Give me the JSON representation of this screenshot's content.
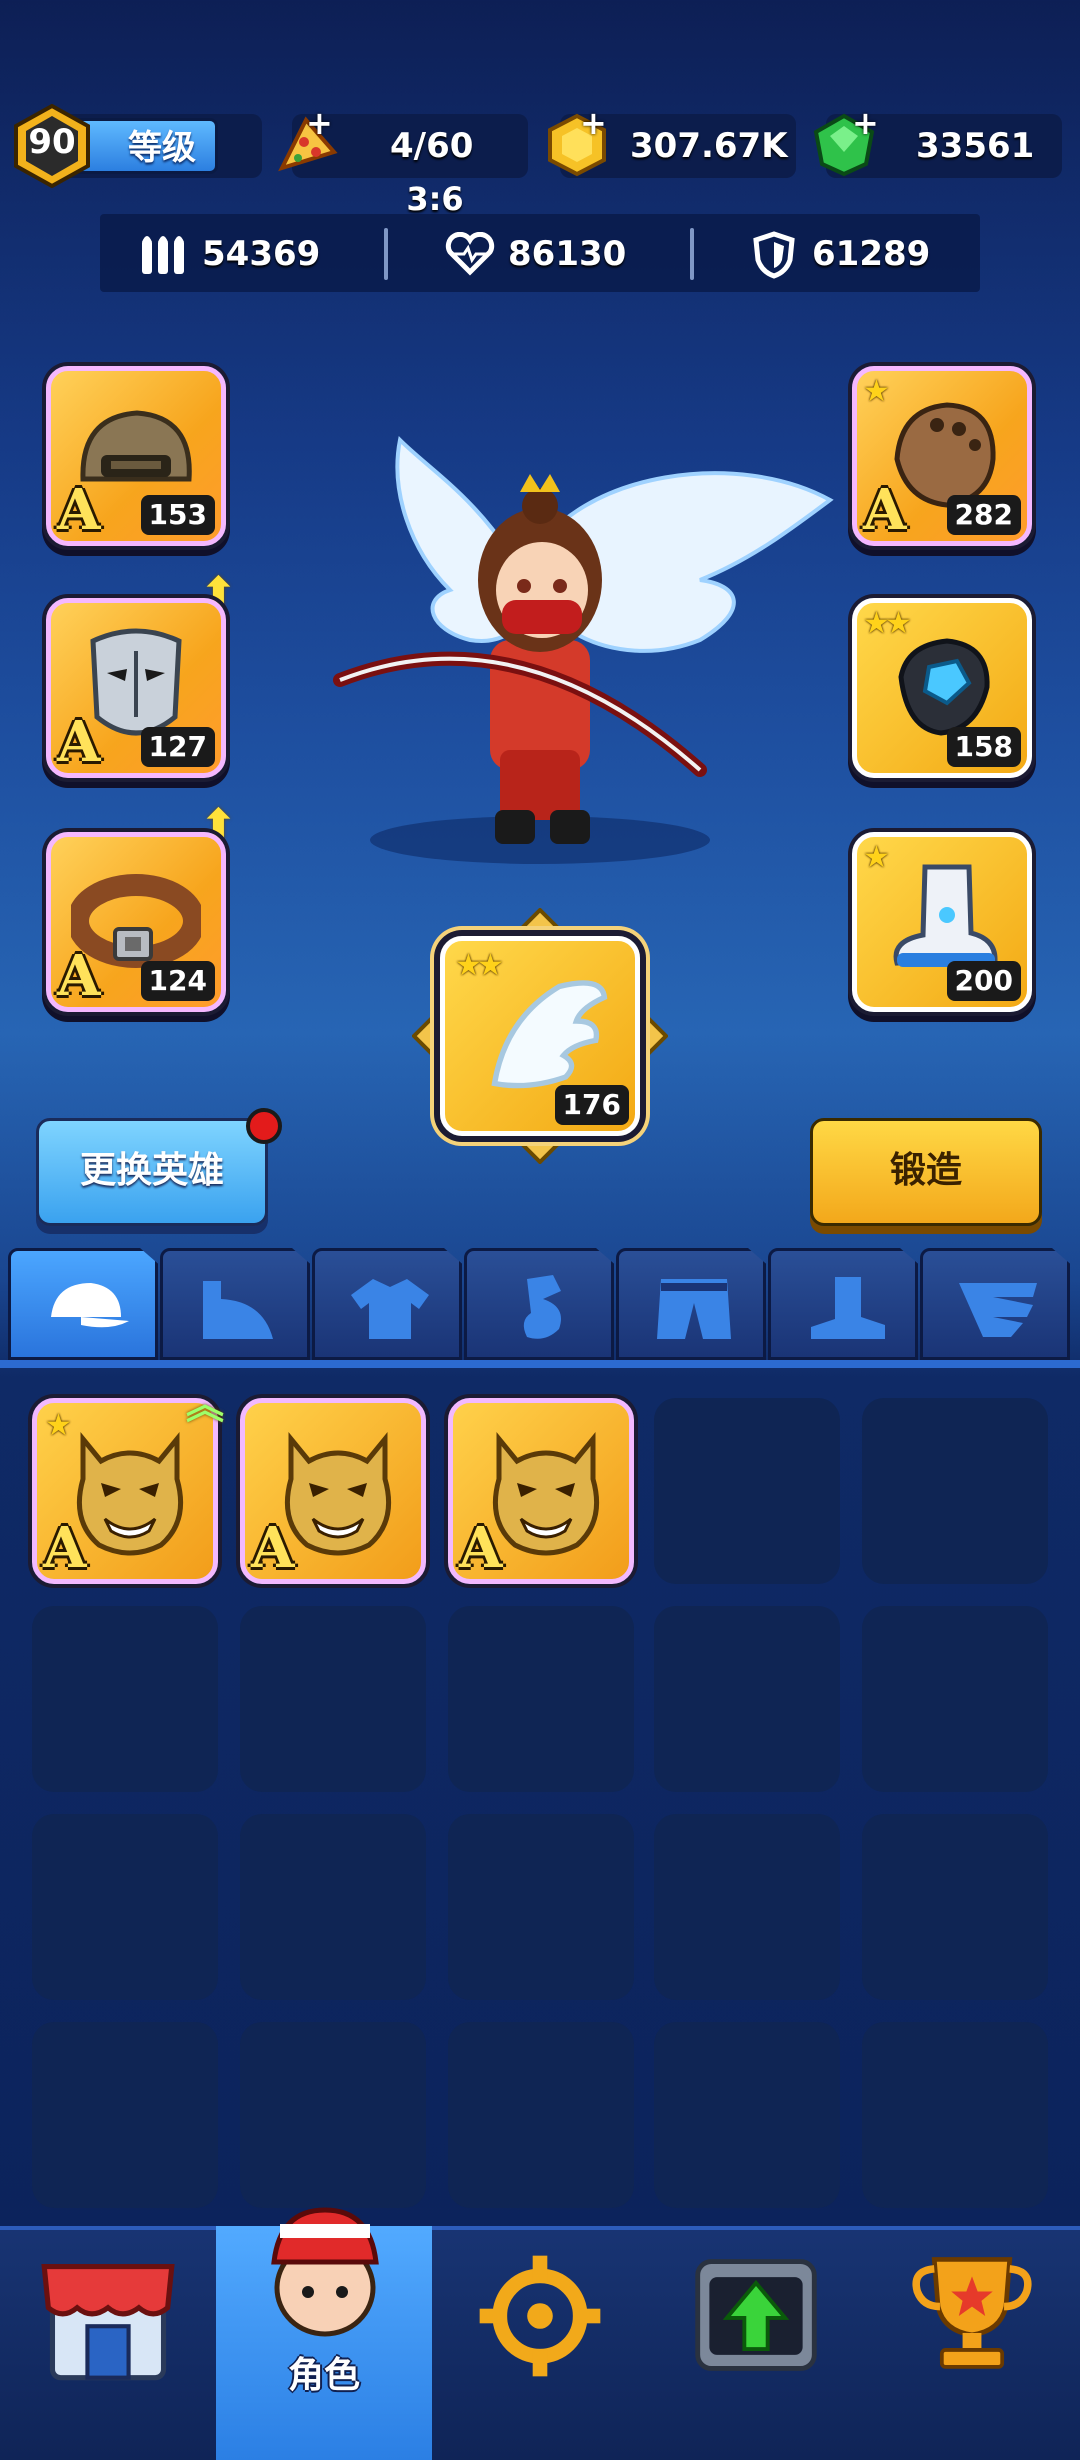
{
  "header": {
    "level": "90",
    "level_label": "等级",
    "energy": "4/60",
    "energy_timer": "3:6",
    "gold": "307.67K",
    "gems": "33561"
  },
  "stats": {
    "attack": "54369",
    "health": "86130",
    "defense": "61289"
  },
  "equipment": {
    "helmet": {
      "grade": "A",
      "level": "153"
    },
    "mask": {
      "grade": "A",
      "level": "127"
    },
    "belt": {
      "grade": "A",
      "level": "124"
    },
    "gauntlet": {
      "grade": "A",
      "level": "282"
    },
    "glove": {
      "level": "158"
    },
    "boots": {
      "level": "200"
    },
    "wings": {
      "level": "176"
    }
  },
  "actions": {
    "change_hero": "更换英雄",
    "forge": "锻造"
  },
  "inventory": [
    {
      "icon": "oni-mask-icon",
      "grade": "A"
    },
    {
      "icon": "oni-mask-icon",
      "grade": "A"
    },
    {
      "icon": "oni-mask-icon",
      "grade": "A"
    }
  ],
  "bottom_nav": {
    "character_label": "角色"
  },
  "colors": {
    "accent_blue": "#2a74dc",
    "gold": "#f3a914",
    "notify_red": "#e31b1b"
  }
}
